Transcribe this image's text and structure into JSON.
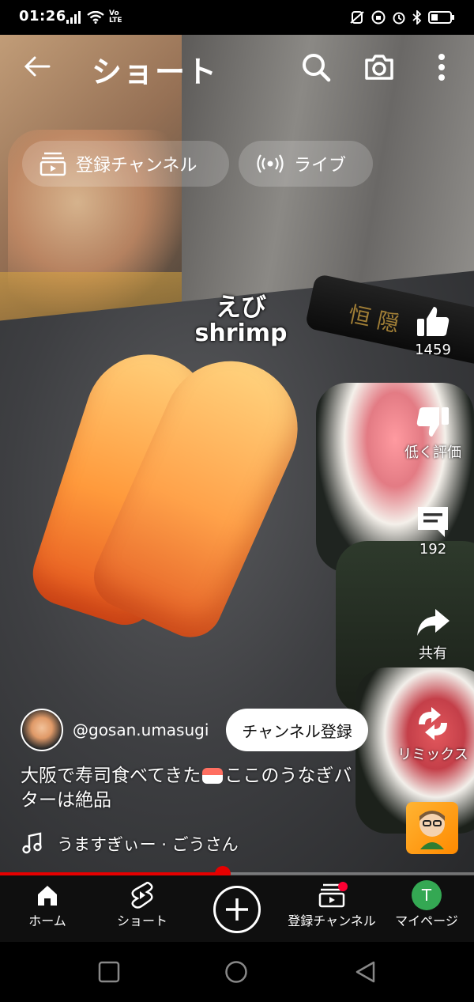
{
  "status_bar": {
    "time": "01:26",
    "left_icons": [
      "signal-icon",
      "wifi-icon",
      "volte-icon"
    ],
    "volte_label": "Vo\nLTE",
    "right_icons": [
      "mute-icon",
      "data-saver-icon",
      "alarm-icon",
      "bluetooth-icon",
      "battery-icon"
    ]
  },
  "header": {
    "title": "ショート",
    "icons": [
      "back-arrow-icon",
      "search-icon",
      "camera-icon",
      "more-vert-icon"
    ]
  },
  "chips": [
    {
      "label": "登録チャンネル",
      "icon": "subscriptions-icon"
    },
    {
      "label": "ライブ",
      "icon": "live-icon"
    }
  ],
  "video_overlay": {
    "label_jp": "えび",
    "label_en": "shrimp",
    "chopstick_text": "恒 隠"
  },
  "actions": {
    "like_count": "1459",
    "dislike_label": "低く評価",
    "comment_count": "192",
    "share_label": "共有",
    "remix_label": "リミックス"
  },
  "video_info": {
    "channel": "@gosan.umasugi",
    "subscribe_label": "チャンネル登録",
    "caption_before": "大阪で寿司食べてきた",
    "caption_after": "ここのうなぎバターは絶品",
    "sound": "うますぎぃー · ごうさん"
  },
  "progress": {
    "fraction": 0.47,
    "color": "#e60000"
  },
  "bottom_nav": [
    {
      "label": "ホーム",
      "icon": "home-icon"
    },
    {
      "label": "ショート",
      "icon": "shorts-icon"
    },
    {
      "label": "",
      "icon": "create-icon"
    },
    {
      "label": "登録チャンネル",
      "icon": "subscriptions-icon"
    },
    {
      "label": "マイページ",
      "icon": "profile-avatar",
      "avatar_letter": "T",
      "avatar_color": "#34a853"
    }
  ],
  "system_nav": [
    "recents-icon",
    "home-circle-icon",
    "back-triangle-icon"
  ]
}
